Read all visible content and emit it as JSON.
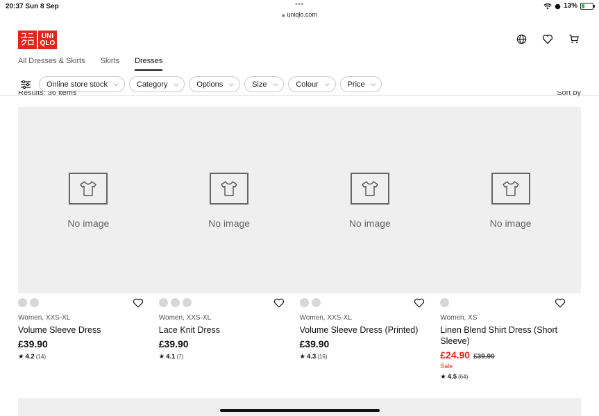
{
  "status_bar": {
    "time": "20:37  Sun 8 Sep",
    "dots": "•••",
    "url": "uniqlo.com",
    "battery_text": "13%"
  },
  "brand": {
    "logo_top_left": "ユニ",
    "logo_bottom_left": "クロ",
    "logo_top_right": "UNI",
    "logo_bottom_right": "QLO",
    "accent_color": "#e3261c"
  },
  "header_icons": [
    "globe-icon",
    "heart-icon",
    "cart-icon"
  ],
  "subnav": {
    "items": [
      {
        "label": "All Dresses & Skirts",
        "active": false
      },
      {
        "label": "Skirts",
        "active": false
      },
      {
        "label": "Dresses",
        "active": true
      }
    ]
  },
  "filters": {
    "pills": [
      {
        "label": "Online store stock"
      },
      {
        "label": "Category"
      },
      {
        "label": "Options"
      },
      {
        "label": "Size"
      },
      {
        "label": "Colour"
      },
      {
        "label": "Price"
      }
    ]
  },
  "results": {
    "count_text": "Results: 36 items",
    "sort_label": "Sort by"
  },
  "products": [
    {
      "image_text": "No image",
      "swatch_count": 2,
      "meta": "Women, XXS-XL",
      "name": "Volume Sleeve Dress",
      "price": "£39.90",
      "original_price": "",
      "sale_label": "",
      "rating": "4.2",
      "review_count": "(14)"
    },
    {
      "image_text": "No image",
      "swatch_count": 3,
      "meta": "Women, XXS-XL",
      "name": "Lace Knit Dress",
      "price": "£39.90",
      "original_price": "",
      "sale_label": "",
      "rating": "4.1",
      "review_count": "(7)"
    },
    {
      "image_text": "No image",
      "swatch_count": 2,
      "meta": "Women, XXS-XL",
      "name": "Volume Sleeve Dress (Printed)",
      "price": "£39.90",
      "original_price": "",
      "sale_label": "",
      "rating": "4.3",
      "review_count": "(16)"
    },
    {
      "image_text": "No image",
      "swatch_count": 1,
      "meta": "Women, XS",
      "name": "Linen Blend Shirt Dress (Short Sleeve)",
      "price": "£24.90",
      "original_price": "£39.90",
      "sale_label": "Sale",
      "rating": "4.5",
      "review_count": "(64)"
    }
  ]
}
